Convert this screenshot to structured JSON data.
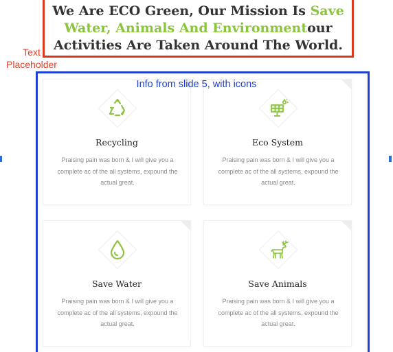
{
  "heading": {
    "part1": "We Are ECO Green, Our Mission Is ",
    "accent": "Save Water, Animals And Environment",
    "part2": "our Activities Are Taken Around The World."
  },
  "annotations": {
    "text_placeholder": "Text Placeholder",
    "grid_label": "Info from slide 5, with icons"
  },
  "colors": {
    "accent": "#8cc43f",
    "heading_border": "#d93a1e",
    "grid_border": "#1f3fd1"
  },
  "cards": [
    {
      "icon": "recycle-icon",
      "title": "Recycling",
      "desc": "Praising pain was born & I will give you a complete ac of the all systems, expound the actual great."
    },
    {
      "icon": "solar-panel-icon",
      "title": "Eco System",
      "desc": "Praising pain was born & I will give you a complete ac of the all systems, expound the actual great."
    },
    {
      "icon": "water-drop-icon",
      "title": "Save Water",
      "desc": "Praising pain was born & I will give you a complete ac of the all systems, expound the actual great."
    },
    {
      "icon": "deer-icon",
      "title": "Save Animals",
      "desc": "Praising pain was born & I will give you a complete ac of the all systems, expound the actual great."
    }
  ]
}
